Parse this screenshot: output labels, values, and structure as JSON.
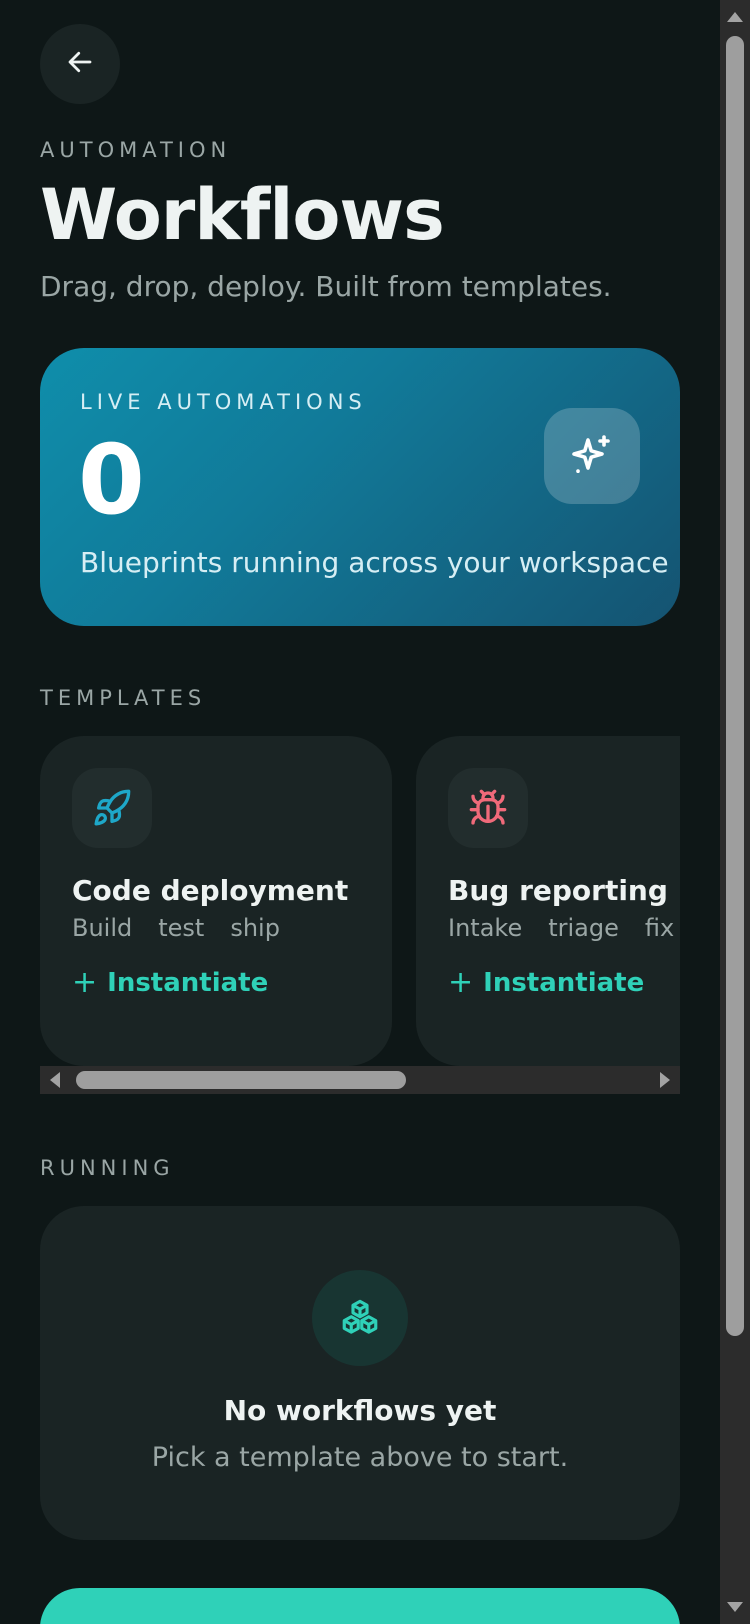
{
  "header": {
    "back_icon": "arrow-left-icon",
    "eyebrow": "AUTOMATION",
    "title": "Workflows",
    "subtitle": "Drag, drop, deploy. Built from templates."
  },
  "hero": {
    "label": "LIVE AUTOMATIONS",
    "value": "0",
    "description": "Blueprints running across your workspace",
    "icon": "sparkles-icon"
  },
  "templates": {
    "section_label": "TEMPLATES",
    "items": [
      {
        "name": "Code deployment",
        "tags": [
          "Build",
          "test",
          "ship"
        ],
        "action": "Instantiate",
        "icon": "rocket-icon",
        "icon_color": "#1ea7c8"
      },
      {
        "name": "Bug reporting",
        "tags": [
          "Intake",
          "triage",
          "fix"
        ],
        "action": "Instantiate",
        "icon": "bug-icon",
        "icon_color": "#f06a7a"
      }
    ]
  },
  "running": {
    "section_label": "RUNNING",
    "empty_icon": "cubes-icon",
    "empty_title": "No workflows yet",
    "empty_description": "Pick a template above to start."
  },
  "colors": {
    "background": "#0e1717",
    "card": "#1a2424",
    "accent": "#2fd1b8",
    "hero_gradient_start": "#0f8eab",
    "hero_gradient_end": "#155371"
  }
}
